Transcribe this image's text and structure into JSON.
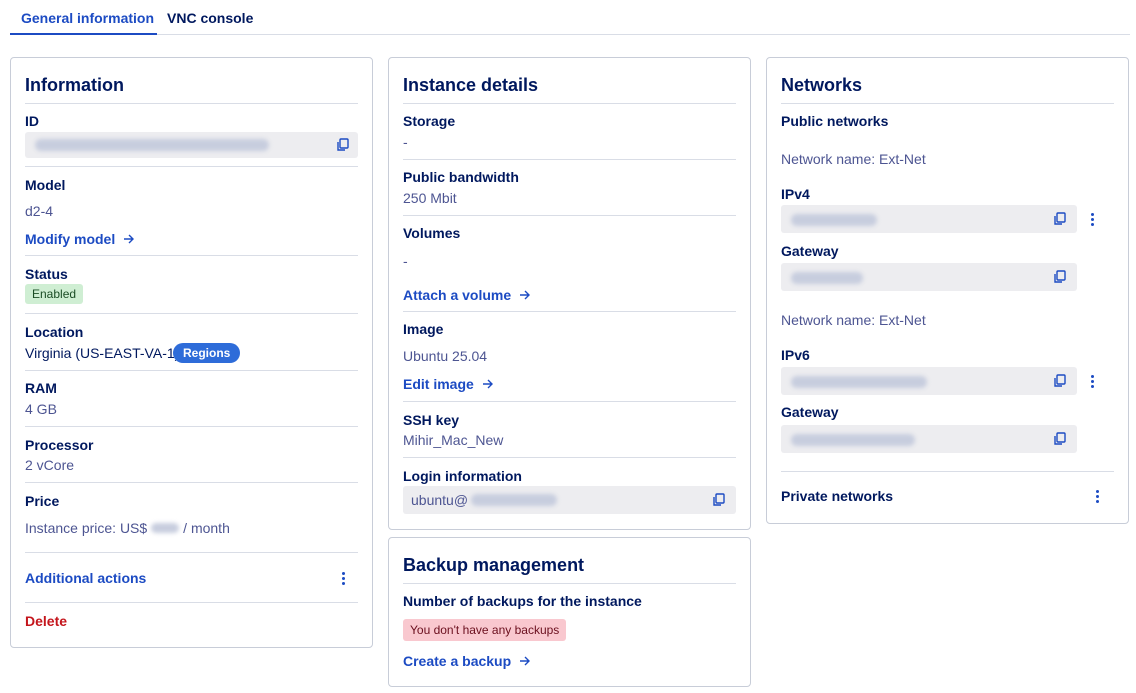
{
  "tabs": [
    {
      "label": "General information",
      "active": true
    },
    {
      "label": "VNC console",
      "active": false
    }
  ],
  "information": {
    "title": "Information",
    "id_label": "ID",
    "model_label": "Model",
    "model_value": "d2-4",
    "modify_model": "Modify model",
    "status_label": "Status",
    "status_value": "Enabled",
    "location_label": "Location",
    "location_value": "Virginia (US-EAST-VA-1)",
    "regions_badge": "Regions",
    "ram_label": "RAM",
    "ram_value": "4 GB",
    "processor_label": "Processor",
    "processor_value": "2 vCore",
    "price_label": "Price",
    "price_prefix": "Instance price: US$",
    "price_suffix": "/ month",
    "additional_actions": "Additional actions",
    "delete": "Delete"
  },
  "instance": {
    "title": "Instance details",
    "storage_label": "Storage",
    "storage_value": "-",
    "bandwidth_label": "Public bandwidth",
    "bandwidth_value": "250 Mbit",
    "volumes_label": "Volumes",
    "volumes_value": "-",
    "attach_volume": "Attach a volume",
    "image_label": "Image",
    "image_value": "Ubuntu 25.04",
    "edit_image": "Edit image",
    "ssh_label": "SSH key",
    "ssh_value": "Mihir_Mac_New",
    "login_label": "Login information",
    "login_prefix": "ubuntu@"
  },
  "backup": {
    "title": "Backup management",
    "count_label": "Number of backups for the instance",
    "no_backups": "You don't have any backups",
    "create_backup": "Create a backup"
  },
  "networks": {
    "title": "Networks",
    "public_label": "Public networks",
    "network1_name": "Network name: Ext-Net",
    "ipv4_label": "IPv4",
    "gateway1_label": "Gateway",
    "network2_name": "Network name: Ext-Net",
    "ipv6_label": "IPv6",
    "gateway2_label": "Gateway",
    "private_label": "Private networks"
  },
  "colors": {
    "primary": "#1c4bc3",
    "text": "#00185e",
    "danger": "#c4151c",
    "success_bg": "#cfeed3",
    "error_bg": "#f9c8cf"
  }
}
